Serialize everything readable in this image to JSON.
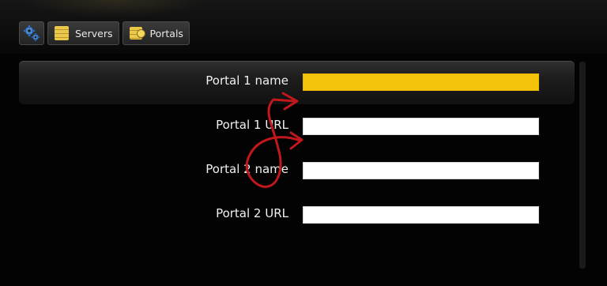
{
  "toolbar": {
    "tabs": [
      {
        "icon": "gear-icon",
        "label": ""
      },
      {
        "icon": "servers-icon",
        "label": "Servers"
      },
      {
        "icon": "portals-icon",
        "label": "Portals"
      }
    ]
  },
  "form": {
    "fields": [
      {
        "label": "Portal 1 name",
        "value": "",
        "focused": true
      },
      {
        "label": "Portal 1 URL",
        "value": "",
        "focused": false
      },
      {
        "label": "Portal 2 name",
        "value": "",
        "focused": false
      },
      {
        "label": "Portal 2 URL",
        "value": "",
        "focused": false
      }
    ]
  },
  "annotation": {
    "color": "#c0181c"
  }
}
